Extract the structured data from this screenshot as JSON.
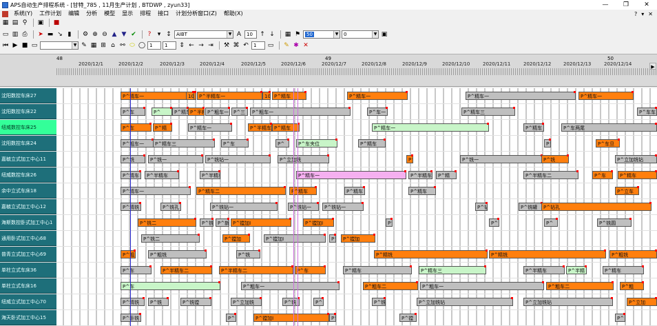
{
  "titlebar": {
    "title": "APS自动生产排程系统 - [甘特_785 , 11月生产计划 , BTDWP , zyun33]",
    "minimize": "—",
    "maximize": "❐",
    "close": "✕"
  },
  "menu": {
    "items": [
      "系统(Y)",
      "工作计划",
      "编辑",
      "分析",
      "模型",
      "显示",
      "排程",
      "接口",
      "计划分析窗口(Z)",
      "帮助(X)"
    ],
    "right_controls": [
      "?",
      "▾",
      "✕"
    ]
  },
  "toolbar2": {
    "font_combo": "AIBT",
    "size_value": "10",
    "color_combo_left": "50",
    "color_combo_right": "0"
  },
  "toolbar3": {
    "spin_a": "1",
    "spin_b": "1",
    "spin_c": "1"
  },
  "timeline": {
    "weeks": [
      "48",
      "49",
      "50"
    ],
    "dates": [
      "2020/12/1",
      "2020/12/2",
      "2020/12/3",
      "2020/12/4",
      "2020/12/5",
      "2020/12/6",
      "2020/12/7",
      "2020/12/8",
      "2020/12/9",
      "2020/12/10",
      "2020/12/11",
      "2020/12/12",
      "2020/12/13",
      "2020/12/14"
    ]
  },
  "resources": [
    {
      "name": "沈阳数控车床27",
      "active": false
    },
    {
      "name": "沈阳数控车床22",
      "active": false
    },
    {
      "name": "纽威数控车床25",
      "active": true
    },
    {
      "name": "沈阳数控车床24",
      "active": false
    },
    {
      "name": "嘉毓立式加工中心11",
      "active": false
    },
    {
      "name": "纽威数控车床26",
      "active": false
    },
    {
      "name": "余中立式车床18",
      "active": false
    },
    {
      "name": "嘉毓立式加工中心12",
      "active": false
    },
    {
      "name": "海斯数控卧式加工中心1",
      "active": false
    },
    {
      "name": "通用卧式加工中心68",
      "active": false
    },
    {
      "name": "普青立式加工中心69",
      "active": false
    },
    {
      "name": "单柱立式车床36",
      "active": false
    },
    {
      "name": "单柱立式车床16",
      "active": false
    },
    {
      "name": "纽威立式加工中心70",
      "active": false
    },
    {
      "name": "海天卧式加工中心15",
      "active": false
    }
  ],
  "rows": [
    [
      {
        "t": "P^精车一",
        "c": "orange",
        "l": 175,
        "w": 110
      },
      {
        "t": "10",
        "c": "orange",
        "l": 270,
        "w": 12
      },
      {
        "t": "P^半精车一",
        "c": "orange",
        "l": 286,
        "w": 95
      },
      {
        "t": "10",
        "c": "orange",
        "l": 381,
        "w": 12
      },
      {
        "t": "P^精车",
        "c": "orange",
        "l": 395,
        "w": 50
      },
      {
        "t": "P^精车一",
        "c": "orange",
        "l": 504,
        "w": 88
      },
      {
        "t": "P^精车一",
        "c": "gray",
        "l": 676,
        "w": 160
      },
      {
        "t": "P^精车一",
        "c": "orange",
        "l": 840,
        "w": 80
      }
    ],
    [
      {
        "t": "P^车",
        "c": "gray",
        "l": 175,
        "w": 36
      },
      {
        "t": "P^",
        "c": "green",
        "l": 220,
        "w": 30
      },
      {
        "t": "P^精车",
        "c": "gray",
        "l": 250,
        "w": 24
      },
      {
        "t": "P^半精",
        "c": "orange",
        "l": 273,
        "w": 24
      },
      {
        "t": "P^粗车一",
        "c": "gray",
        "l": 298,
        "w": 36
      },
      {
        "t": "P^三",
        "c": "gray",
        "l": 336,
        "w": 24
      },
      {
        "t": "P^粗车一",
        "c": "gray",
        "l": 363,
        "w": 146
      },
      {
        "t": "P^车一",
        "c": "gray",
        "l": 533,
        "w": 30
      },
      {
        "t": "P^精车三",
        "c": "gray",
        "l": 670,
        "w": 78
      },
      {
        "t": "P^车车",
        "c": "gray",
        "l": 925,
        "w": 29
      }
    ],
    [
      {
        "t": "P^车",
        "c": "orange",
        "l": 175,
        "w": 45
      },
      {
        "t": "P^精",
        "c": "orange",
        "l": 222,
        "w": 28
      },
      {
        "t": "P^精车一",
        "c": "gray",
        "l": 273,
        "w": 64
      },
      {
        "t": "P^半精车",
        "c": "orange",
        "l": 360,
        "w": 35
      },
      {
        "t": "P^精车",
        "c": "orange",
        "l": 395,
        "w": 40
      },
      {
        "t": "P^精车一",
        "c": "green",
        "l": 540,
        "w": 170
      },
      {
        "t": "P^精车",
        "c": "gray",
        "l": 760,
        "w": 30
      },
      {
        "t": "P^车两尾",
        "c": "gray",
        "l": 815,
        "w": 139
      }
    ],
    [
      {
        "t": "P^粗车一",
        "c": "gray",
        "l": 175,
        "w": 48
      },
      {
        "t": "P^精车三",
        "c": "gray",
        "l": 222,
        "w": 90
      },
      {
        "t": "P^车",
        "c": "gray",
        "l": 321,
        "w": 40
      },
      {
        "t": "P^",
        "c": "gray",
        "l": 400,
        "w": 20
      },
      {
        "t": "P^车夹位",
        "c": "green",
        "l": 430,
        "w": 60
      },
      {
        "t": "P^精车",
        "c": "gray",
        "l": 520,
        "w": 40
      },
      {
        "t": "P^",
        "c": "gray",
        "l": 790,
        "w": 10
      },
      {
        "t": "P^车旦",
        "c": "orange",
        "l": 865,
        "w": 35
      }
    ],
    [
      {
        "t": "P^铣",
        "c": "gray",
        "l": 175,
        "w": 36
      },
      {
        "t": "P^铣一",
        "c": "gray",
        "l": 215,
        "w": 80
      },
      {
        "t": "P^铣钻一",
        "c": "gray",
        "l": 298,
        "w": 95
      },
      {
        "t": "P^立加铣",
        "c": "gray",
        "l": 403,
        "w": 75
      },
      {
        "t": "P^",
        "c": "orange",
        "l": 590,
        "w": 10
      },
      {
        "t": "P^铣一",
        "c": "gray",
        "l": 668,
        "w": 120
      },
      {
        "t": "P^铣",
        "c": "orange",
        "l": 786,
        "w": 40
      },
      {
        "t": "P^立加铣钻",
        "c": "gray",
        "l": 893,
        "w": 61
      }
    ],
    [
      {
        "t": "P^精车",
        "c": "gray",
        "l": 175,
        "w": 30
      },
      {
        "t": "P^半精车",
        "c": "gray",
        "l": 210,
        "w": 50
      },
      {
        "t": "P^半精车一",
        "c": "gray",
        "l": 290,
        "w": 30
      },
      {
        "t": "P^精车一",
        "c": "pink",
        "l": 430,
        "w": 160
      },
      {
        "t": "P^半精车",
        "c": "gray",
        "l": 593,
        "w": 35
      },
      {
        "t": "P^精",
        "c": "gray",
        "l": 633,
        "w": 30
      },
      {
        "t": "P^半精车二",
        "c": "gray",
        "l": 760,
        "w": 80
      },
      {
        "t": "P^车",
        "c": "orange",
        "l": 860,
        "w": 30
      },
      {
        "t": "P^精车",
        "c": "orange",
        "l": 897,
        "w": 57
      }
    ],
    [
      {
        "t": "P^精车一",
        "c": "gray",
        "l": 175,
        "w": 102
      },
      {
        "t": "P^精车二",
        "c": "orange",
        "l": 285,
        "w": 130
      },
      {
        "t": "P^精车",
        "c": "orange",
        "l": 420,
        "w": 40
      },
      {
        "t": "P^精车",
        "c": "gray",
        "l": 500,
        "w": 30
      },
      {
        "t": "P^精车",
        "c": "gray",
        "l": 593,
        "w": 40
      },
      {
        "t": "P^立车",
        "c": "orange",
        "l": 893,
        "w": 35
      }
    ],
    [
      {
        "t": "P^精铣",
        "c": "gray",
        "l": 175,
        "w": 30
      },
      {
        "t": "P^铣孔",
        "c": "gray",
        "l": 233,
        "w": 30
      },
      {
        "t": "P^铣钻一",
        "c": "gray",
        "l": 305,
        "w": 98
      },
      {
        "t": "P^铣钻一",
        "c": "gray",
        "l": 418,
        "w": 45
      },
      {
        "t": "P^铣钻一",
        "c": "gray",
        "l": 468,
        "w": 60
      },
      {
        "t": "P^钻",
        "c": "gray",
        "l": 690,
        "w": 18
      },
      {
        "t": "P^铣罐",
        "c": "gray",
        "l": 753,
        "w": 35
      },
      {
        "t": "P^钻孔",
        "c": "orange",
        "l": 786,
        "w": 160
      }
    ],
    [
      {
        "t": "P^铣二",
        "c": "orange",
        "l": 200,
        "w": 85
      },
      {
        "t": "P^铣",
        "c": "gray",
        "l": 290,
        "w": 20
      },
      {
        "t": "P^新加I",
        "c": "gray",
        "l": 313,
        "w": 20
      },
      {
        "t": "P^镗加I",
        "c": "orange",
        "l": 335,
        "w": 88
      },
      {
        "t": "P^镗加I",
        "c": "orange",
        "l": 440,
        "w": 45
      },
      {
        "t": "P^",
        "c": "gray",
        "l": 560,
        "w": 10
      },
      {
        "t": "P^",
        "c": "gray",
        "l": 710,
        "w": 15
      },
      {
        "t": "P^",
        "c": "gray",
        "l": 790,
        "w": 20
      },
      {
        "t": "P^铣圆",
        "c": "gray",
        "l": 867,
        "w": 50
      }
    ],
    [
      {
        "t": "P^铣二",
        "c": "gray",
        "l": 205,
        "w": 85
      },
      {
        "t": "P^镗加",
        "c": "orange",
        "l": 323,
        "w": 40
      },
      {
        "t": "P^镗加I",
        "c": "gray",
        "l": 383,
        "w": 90
      },
      {
        "t": "P^",
        "c": "gray",
        "l": 478,
        "w": 10
      },
      {
        "t": "P^镗加",
        "c": "orange",
        "l": 495,
        "w": 50
      }
    ],
    [
      {
        "t": "P^粗",
        "c": "orange",
        "l": 175,
        "w": 22
      },
      {
        "t": "P^粗铣",
        "c": "gray",
        "l": 215,
        "w": 85
      },
      {
        "t": "P^铣",
        "c": "gray",
        "l": 343,
        "w": 35
      },
      {
        "t": "P^精铣",
        "c": "orange",
        "l": 543,
        "w": 165
      },
      {
        "t": "P^精铣",
        "c": "orange",
        "l": 710,
        "w": 170
      },
      {
        "t": "P^粗铣",
        "c": "orange",
        "l": 885,
        "w": 69
      }
    ],
    [
      {
        "t": "P^车",
        "c": "gray",
        "l": 175,
        "w": 45
      },
      {
        "t": "P^半精车二",
        "c": "orange",
        "l": 233,
        "w": 75
      },
      {
        "t": "P^半精车二",
        "c": "orange",
        "l": 318,
        "w": 108
      },
      {
        "t": "P^车",
        "c": "orange",
        "l": 428,
        "w": 45
      },
      {
        "t": "P^精车",
        "c": "gray",
        "l": 498,
        "w": 100
      },
      {
        "t": "P^精车三",
        "c": "green",
        "l": 608,
        "w": 98
      },
      {
        "t": "P^半精车",
        "c": "gray",
        "l": 760,
        "w": 60
      },
      {
        "t": "P^半精",
        "c": "green",
        "l": 822,
        "w": 30
      },
      {
        "t": "P^精车",
        "c": "gray",
        "l": 875,
        "w": 60
      }
    ],
    [
      {
        "t": "P^车",
        "c": "green",
        "l": 175,
        "w": 145
      },
      {
        "t": "P^粗车一",
        "c": "gray",
        "l": 350,
        "w": 143
      },
      {
        "t": "P^粗车二",
        "c": "orange",
        "l": 527,
        "w": 80
      },
      {
        "t": "P^粗车一",
        "c": "gray",
        "l": 610,
        "w": 180
      },
      {
        "t": "P^粗车二",
        "c": "orange",
        "l": 793,
        "w": 98
      },
      {
        "t": "P^粗",
        "c": "orange",
        "l": 900,
        "w": 35
      }
    ],
    [
      {
        "t": "P^精铣",
        "c": "gray",
        "l": 175,
        "w": 35
      },
      {
        "t": "P^铣",
        "c": "gray",
        "l": 215,
        "w": 30
      },
      {
        "t": "P^铣镗",
        "c": "gray",
        "l": 262,
        "w": 45
      },
      {
        "t": "P^立加铣",
        "c": "gray",
        "l": 335,
        "w": 45
      },
      {
        "t": "P^铣",
        "c": "gray",
        "l": 410,
        "w": 25
      },
      {
        "t": "P^",
        "c": "gray",
        "l": 455,
        "w": 15
      },
      {
        "t": "P^铣",
        "c": "gray",
        "l": 540,
        "w": 20
      },
      {
        "t": "P^立加铣钻",
        "c": "gray",
        "l": 605,
        "w": 140
      },
      {
        "t": "P^立加铣钻",
        "c": "gray",
        "l": 760,
        "w": 130
      },
      {
        "t": "P^立加",
        "c": "orange",
        "l": 910,
        "w": 44
      }
    ],
    [
      {
        "t": "P^卧铣",
        "c": "gray",
        "l": 175,
        "w": 30
      },
      {
        "t": "P^",
        "c": "gray",
        "l": 328,
        "w": 15
      },
      {
        "t": "P^镗加I",
        "c": "orange",
        "l": 368,
        "w": 110
      },
      {
        "t": "P^",
        "c": "gray",
        "l": 478,
        "w": 10
      },
      {
        "t": "P^镗",
        "c": "gray",
        "l": 580,
        "w": 25
      },
      {
        "t": "P^",
        "c": "gray",
        "l": 893,
        "w": 15
      }
    ]
  ]
}
